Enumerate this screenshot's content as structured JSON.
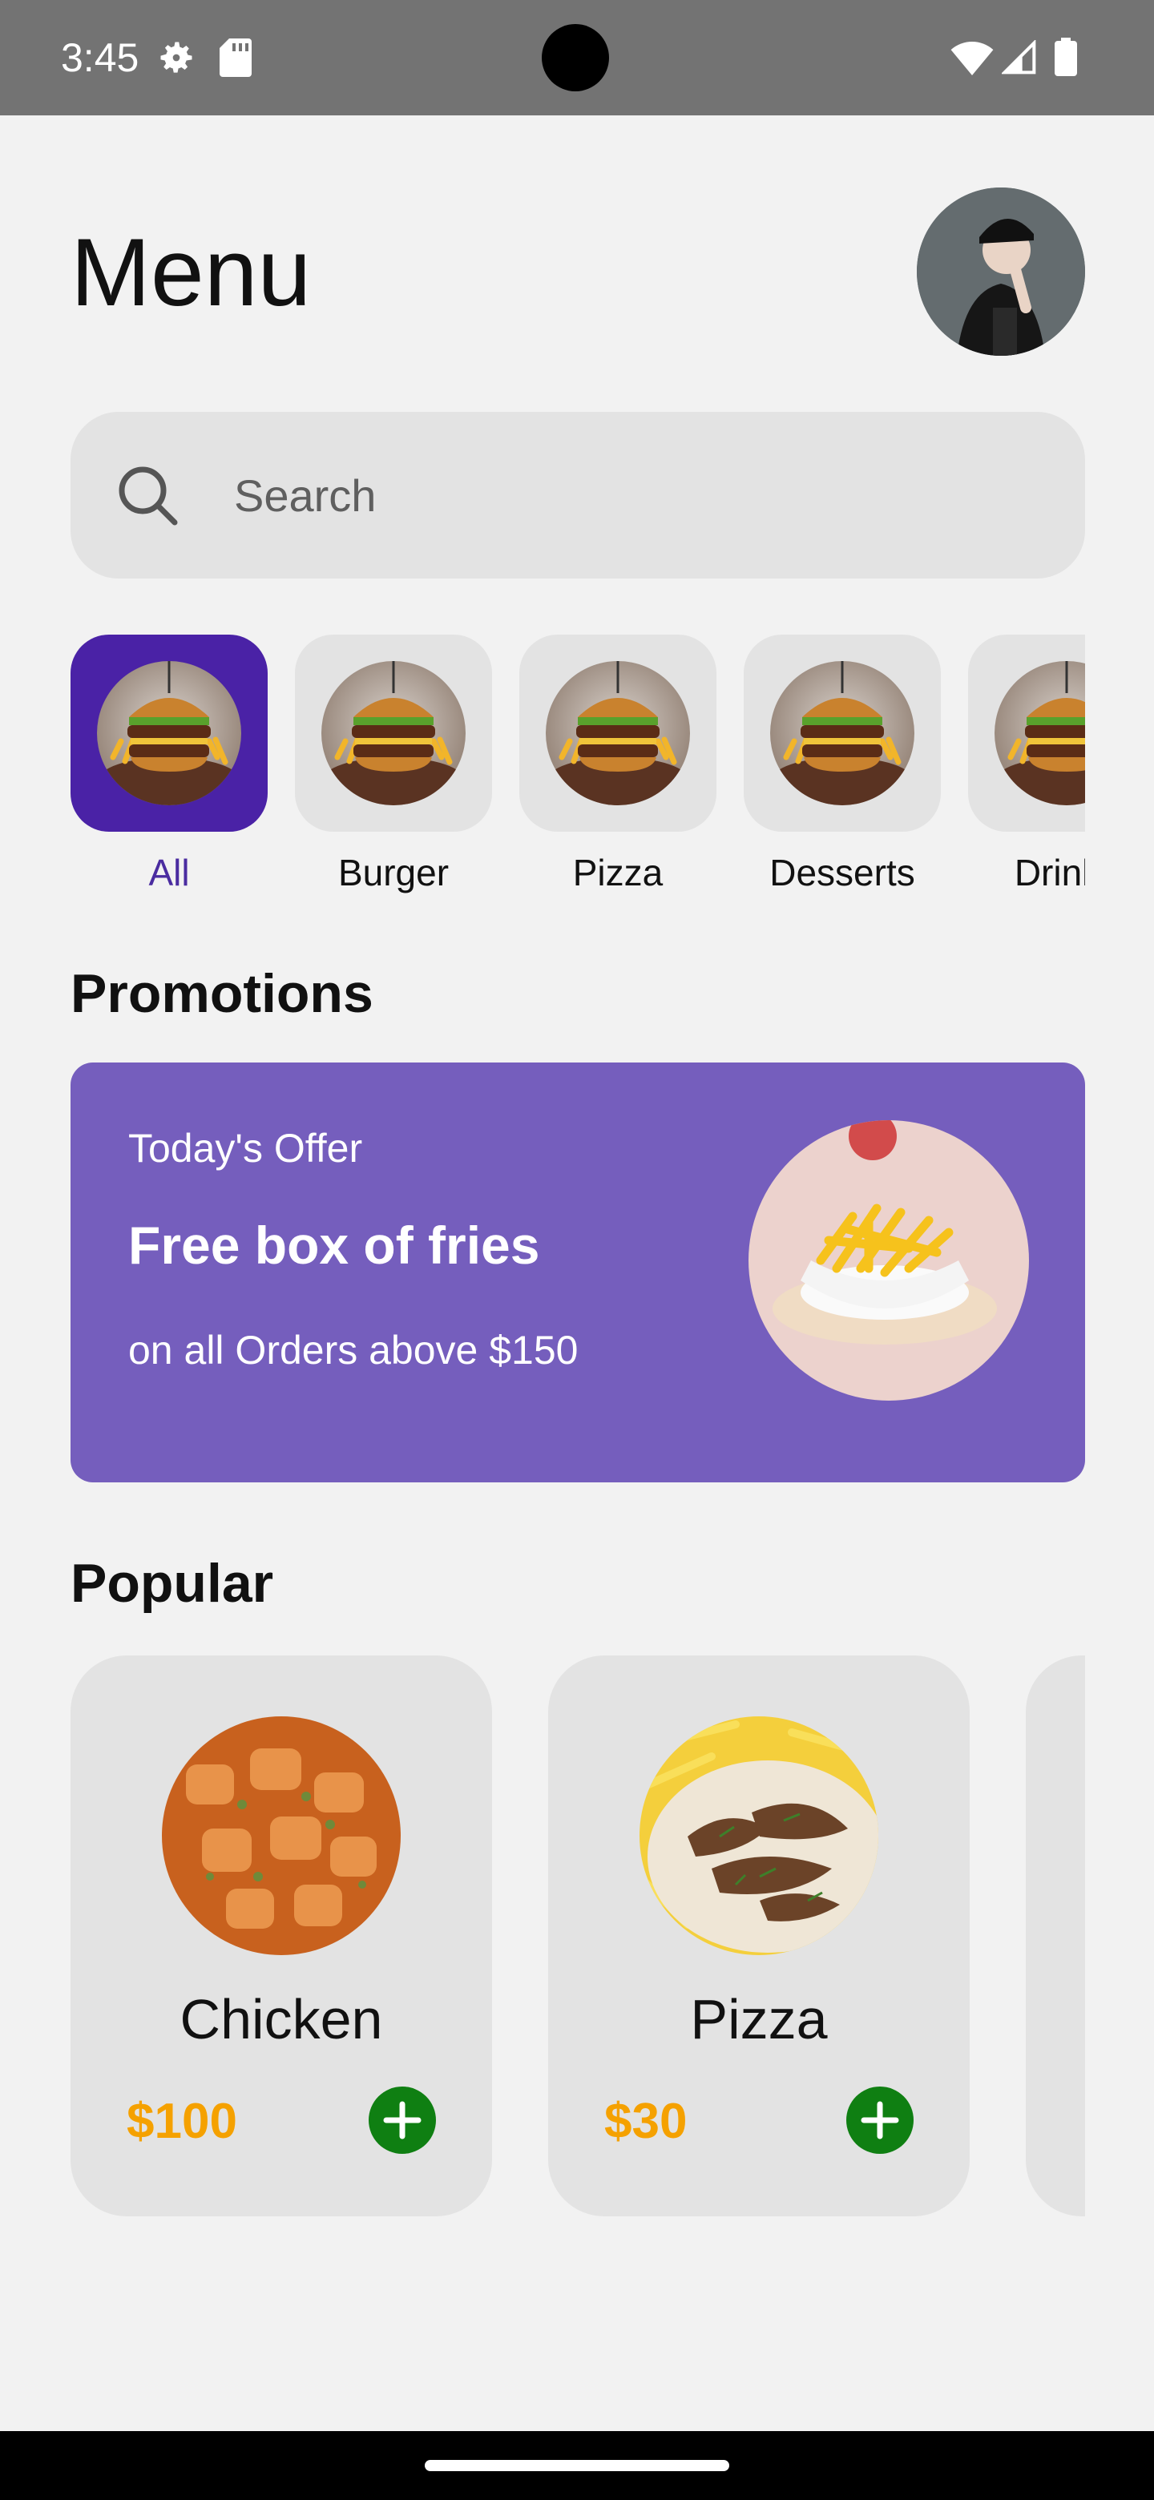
{
  "status_bar": {
    "time": "3:45",
    "icons": [
      "gear-icon",
      "sd-card-icon",
      "wifi-icon",
      "signal-icon",
      "battery-icon"
    ]
  },
  "header": {
    "title": "Menu",
    "avatar_icon": "profile-avatar"
  },
  "search": {
    "placeholder": "Search",
    "icon": "search-icon"
  },
  "categories": {
    "items": [
      {
        "label": "All",
        "active": true
      },
      {
        "label": "Burger",
        "active": false
      },
      {
        "label": "Pizza",
        "active": false
      },
      {
        "label": "Desserts",
        "active": false
      },
      {
        "label": "Drinks",
        "active": false
      }
    ]
  },
  "promotions": {
    "section_title": "Promotions",
    "kicker": "Today's Offer",
    "title": "Free box of fries",
    "subtitle": "on all Orders above $150"
  },
  "popular": {
    "section_title": "Popular",
    "items": [
      {
        "name": "Chicken",
        "price": "$100"
      },
      {
        "name": "Pizza",
        "price": "$30"
      }
    ]
  },
  "colors": {
    "accent": "#4a22a6",
    "promo_bg": "#755ebd",
    "price": "#f5a100",
    "add_button": "#0f7f12",
    "surface": "#e3e3e3",
    "background": "#f2f2f2"
  }
}
